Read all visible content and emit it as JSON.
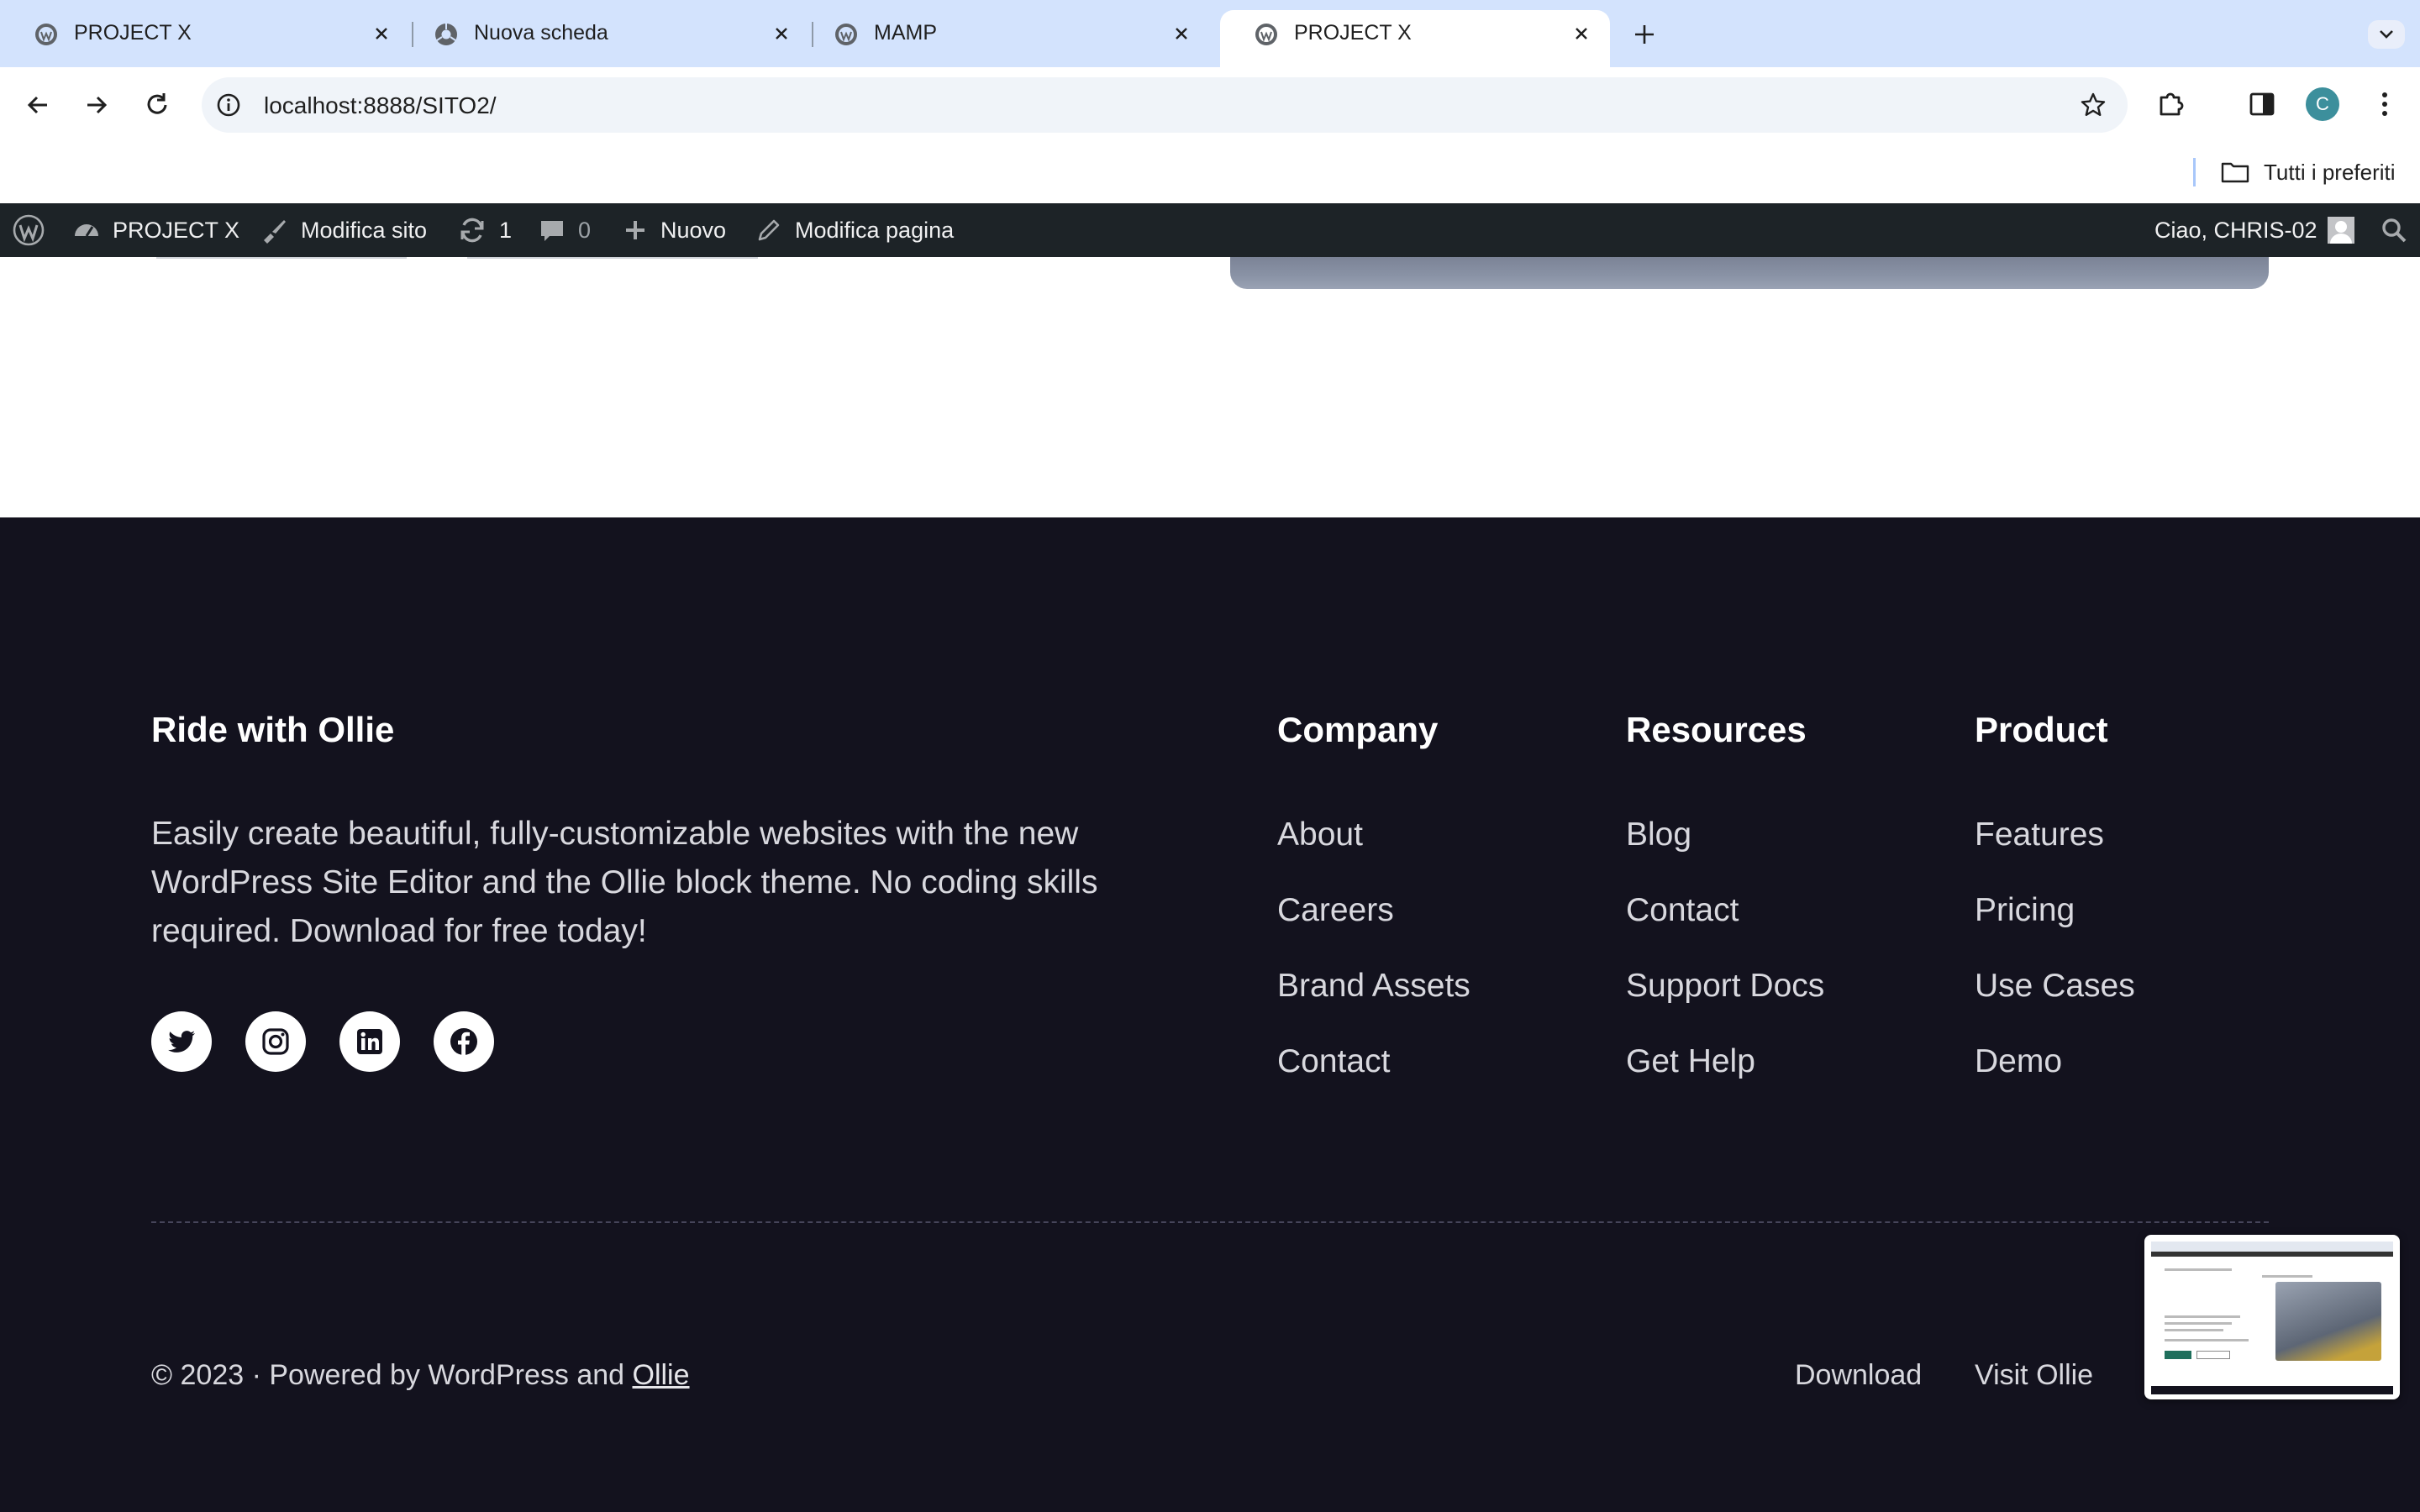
{
  "browser": {
    "tabs": [
      {
        "title": "PROJECT X",
        "icon": "wordpress-favicon-icon",
        "active": false
      },
      {
        "title": "Nuova scheda",
        "icon": "chrome-favicon-icon",
        "active": false
      },
      {
        "title": "MAMP",
        "icon": "wordpress-favicon-icon",
        "active": false
      },
      {
        "title": "PROJECT X",
        "icon": "wordpress-favicon-icon",
        "active": true
      }
    ],
    "url": "localhost:8888/SITO2/",
    "profile_initial": "C",
    "bookmarks_label": "Tutti i preferiti"
  },
  "adminbar": {
    "site_name": "PROJECT X",
    "edit_site": "Modifica sito",
    "updates_count": "1",
    "comments_count": "0",
    "new_label": "Nuovo",
    "edit_page": "Modifica pagina",
    "greeting": "Ciao, CHRIS-02"
  },
  "footer": {
    "brand_title": "Ride with Ollie",
    "description": "Easily create beautiful, fully-customizable websites with the new WordPress Site Editor and the Ollie block theme. No coding skills required. Download for free today!",
    "social": [
      "twitter-icon",
      "instagram-icon",
      "linkedin-icon",
      "facebook-icon"
    ],
    "columns": [
      {
        "title": "Company",
        "links": [
          "About",
          "Careers",
          "Brand Assets",
          "Contact"
        ]
      },
      {
        "title": "Resources",
        "links": [
          "Blog",
          "Contact",
          "Support Docs",
          "Get Help"
        ]
      },
      {
        "title": "Product",
        "links": [
          "Features",
          "Pricing",
          "Use Cases",
          "Demo"
        ]
      }
    ],
    "copyright_prefix": "© 2023 · Powered by WordPress and ",
    "copyright_link": "Ollie",
    "bottom_links": [
      "Download",
      "Visit Ollie"
    ]
  },
  "colors": {
    "tabbar": "#d3e3fd",
    "adminbar": "#1d2327",
    "footer_bg": "#13121e"
  }
}
